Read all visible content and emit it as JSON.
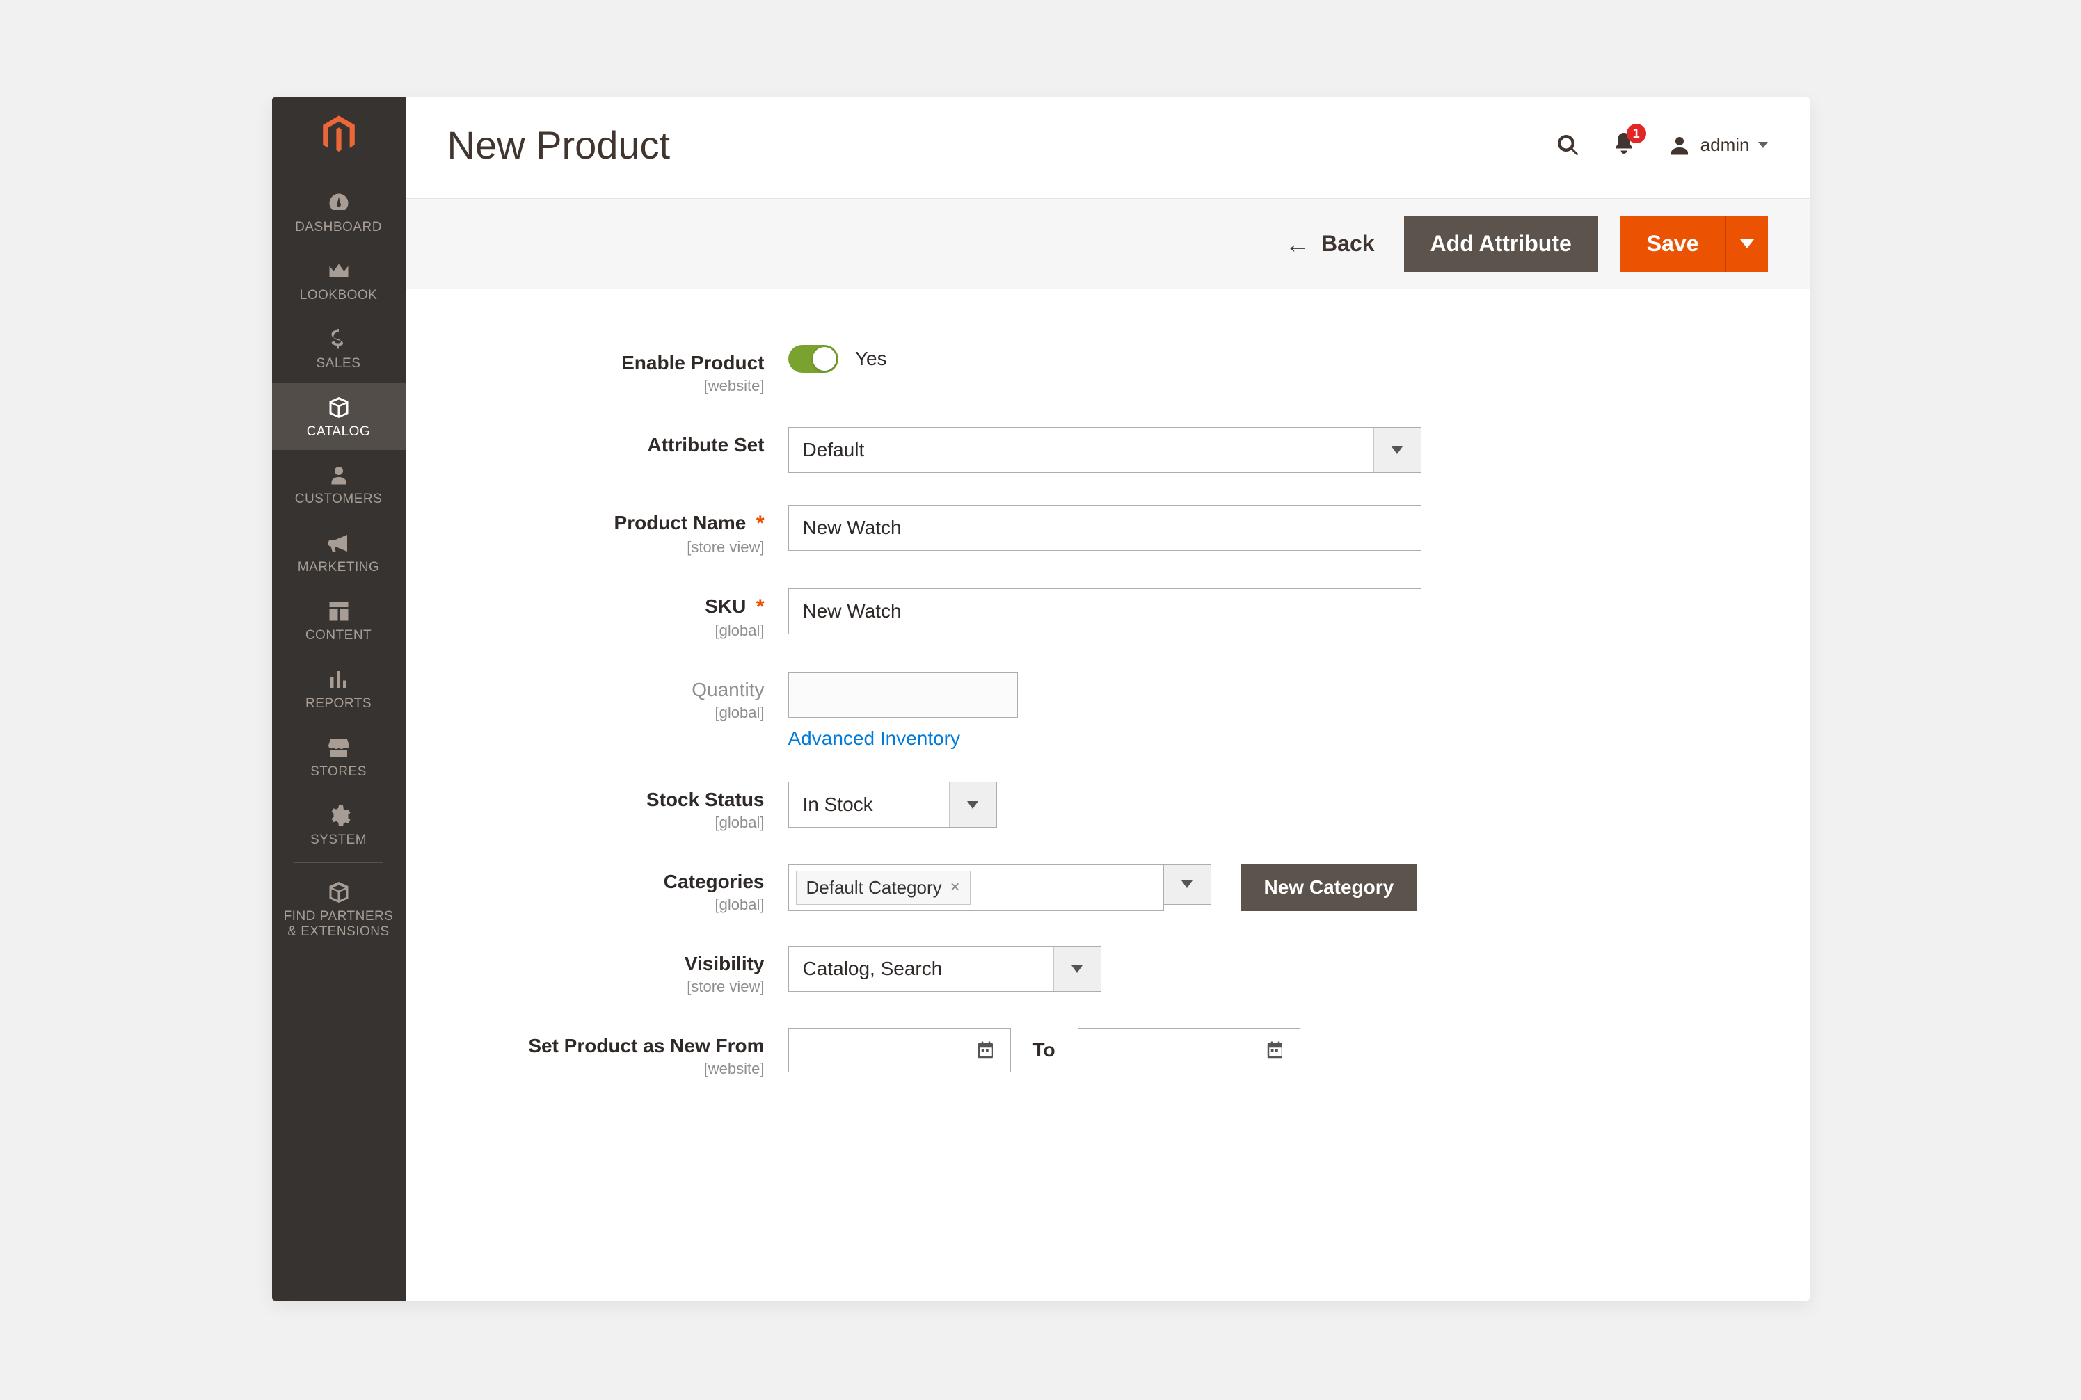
{
  "header": {
    "page_title": "New Product",
    "notifications_count": "1",
    "user_label": "admin"
  },
  "sidebar": {
    "items": [
      {
        "label": "DASHBOARD"
      },
      {
        "label": "LOOKBOOK"
      },
      {
        "label": "SALES"
      },
      {
        "label": "CATALOG"
      },
      {
        "label": "CUSTOMERS"
      },
      {
        "label": "MARKETING"
      },
      {
        "label": "CONTENT"
      },
      {
        "label": "REPORTS"
      },
      {
        "label": "STORES"
      },
      {
        "label": "SYSTEM"
      },
      {
        "label": "FIND PARTNERS\n& EXTENSIONS"
      }
    ]
  },
  "toolbar": {
    "back_label": "Back",
    "add_attribute_label": "Add Attribute",
    "save_label": "Save"
  },
  "form": {
    "enable_product": {
      "label": "Enable Product",
      "scope": "[website]",
      "value_text": "Yes"
    },
    "attribute_set": {
      "label": "Attribute Set",
      "value": "Default"
    },
    "product_name": {
      "label": "Product Name",
      "scope": "[store view]",
      "value": "New Watch"
    },
    "sku": {
      "label": "SKU",
      "scope": "[global]",
      "value": "New Watch"
    },
    "quantity": {
      "label": "Quantity",
      "scope": "[global]",
      "value": "",
      "advanced_link": "Advanced Inventory"
    },
    "stock_status": {
      "label": "Stock Status",
      "scope": "[global]",
      "value": "In Stock"
    },
    "categories": {
      "label": "Categories",
      "scope": "[global]",
      "selected": "Default Category",
      "new_button": "New Category"
    },
    "visibility": {
      "label": "Visibility",
      "scope": "[store view]",
      "value": "Catalog, Search"
    },
    "new_from": {
      "label": "Set Product as New From",
      "scope": "[website]",
      "to_label": "To"
    }
  }
}
